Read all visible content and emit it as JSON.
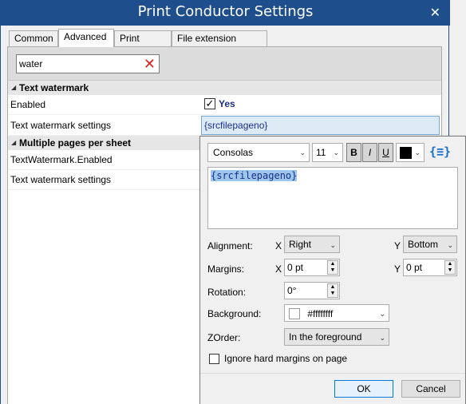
{
  "window": {
    "title": "Print Conductor Settings"
  },
  "tabs": [
    {
      "label": "Common"
    },
    {
      "label": "Advanced"
    },
    {
      "label": "Print engine"
    },
    {
      "label": "File extension aliases"
    }
  ],
  "search": {
    "value": "water"
  },
  "groups": {
    "text_watermark": {
      "title": "Text watermark",
      "enabled_label": "Enabled",
      "enabled_value": "Yes",
      "settings_label": "Text watermark settings",
      "settings_value": "{srcfilepageno}"
    },
    "multiple_pages": {
      "title": "Multiple pages per sheet",
      "enabled_label": "TextWatermark.Enabled",
      "settings_label": "Text watermark settings"
    }
  },
  "popup": {
    "font": "Consolas",
    "size": "11",
    "bold": "B",
    "italic": "I",
    "underline": "U",
    "macro_icon": "{≡}",
    "text": "{srcfilepageno}",
    "alignment_label": "Alignment:",
    "x_label": "X",
    "y_label": "Y",
    "align_x": "Right",
    "align_y": "Bottom",
    "margins_label": "Margins:",
    "margin_x": "0 pt",
    "margin_y": "0 pt",
    "rotation_label": "Rotation:",
    "rotation": "0°",
    "background_label": "Background:",
    "background_value": "#ffffffff",
    "zorder_label": "ZOrder:",
    "zorder_value": "In the foreground",
    "ignore_margins_label": "Ignore hard margins on page",
    "ok": "OK",
    "cancel": "Cancel"
  },
  "colors": {
    "titlebar": "#1e4e8c",
    "accent": "#0078d7",
    "clear_icon": "#e02020"
  }
}
